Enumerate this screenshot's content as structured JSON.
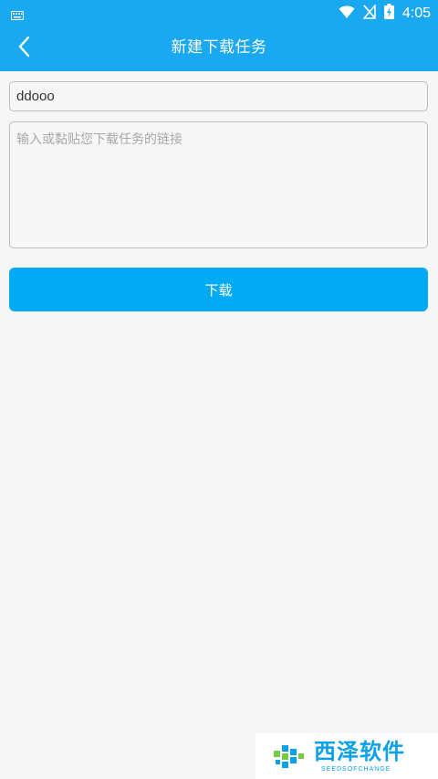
{
  "status_bar": {
    "time": "4:05",
    "icons": [
      "keyboard-icon",
      "wifi-icon",
      "no-signal-icon",
      "battery-charging-icon"
    ]
  },
  "app_bar": {
    "title": "新建下载任务",
    "back_icon": "chevron-left-icon"
  },
  "form": {
    "name_value": "ddooo",
    "link_value": "",
    "link_placeholder": "输入或黏贴您下载任务的链接",
    "download_label": "下载"
  },
  "watermark": {
    "text": "西泽软件",
    "subtext": "SEEDSOFCHANGE"
  },
  "colors": {
    "primary": "#1aa8f0",
    "button": "#02aaf3",
    "background": "#f6f6f6"
  }
}
